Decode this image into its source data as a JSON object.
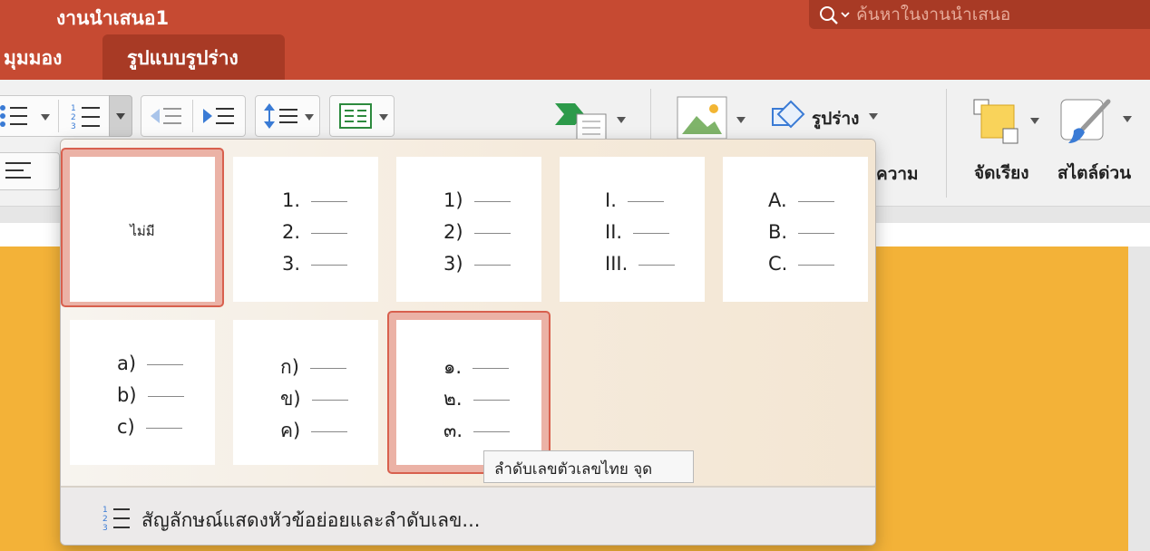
{
  "window": {
    "title": "งานนำเสนอ1"
  },
  "search": {
    "placeholder": "ค้นหาในงานนำเสนอ"
  },
  "tabs": [
    {
      "label": "มุมมอง"
    },
    {
      "label": "รูปแบบรูปร่าง"
    }
  ],
  "ribbon": {
    "shape_label": "รูปร่าง",
    "text_partial_label": "ความ",
    "arrange_label": "จัดเรียง",
    "quick_styles_label": "สไตล์ด่วน"
  },
  "numbering_gallery": {
    "none_label": "ไม่มี",
    "styles": [
      {
        "items": [
          "1.",
          "2.",
          "3."
        ]
      },
      {
        "items": [
          "1)",
          "2)",
          "3)"
        ]
      },
      {
        "items": [
          "I.",
          "II.",
          "III."
        ]
      },
      {
        "items": [
          "A.",
          "B.",
          "C."
        ]
      },
      {
        "items": [
          "a)",
          "b)",
          "c)"
        ]
      },
      {
        "items": [
          "ก)",
          "ข)",
          "ค)"
        ]
      },
      {
        "items": [
          "๑.",
          "๒.",
          "๓."
        ]
      }
    ],
    "selected_index": 7,
    "footer_label": "สัญลักษณ์แสดงหัวข้อย่อยและลำดับเลข...",
    "tooltip": "ลำดับเลขตัวเลขไทย จุด"
  },
  "colors": {
    "accent": "#c64a32",
    "accent_dark": "#a83a25",
    "slide": "#f3b238"
  }
}
